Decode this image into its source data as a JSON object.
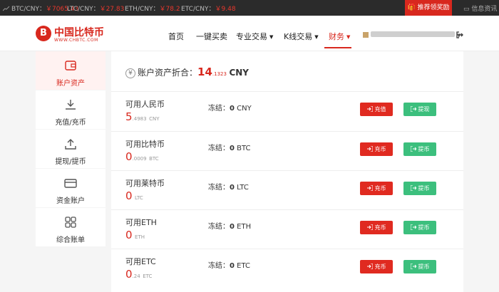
{
  "ticker": [
    {
      "pair": "BTC/CNY：",
      "price": "￥7065.43"
    },
    {
      "pair": "LTC/CNY：",
      "price": "￥27.83"
    },
    {
      "pair": "ETH/CNY：",
      "price": "￥78.2"
    },
    {
      "pair": "ETC/CNY：",
      "price": "￥9.48"
    }
  ],
  "promo_label": "推荐领奖励",
  "message_center": "信息资讯",
  "logo": {
    "name": "中国比特币",
    "url": "WWW.CHBTC.COM"
  },
  "nav": [
    "首页",
    "一键买卖",
    "专业交易",
    "K线交易",
    "财务"
  ],
  "sidebar": [
    "账户资产",
    "充值/充币",
    "提现/提币",
    "资金账户",
    "综合账单"
  ],
  "summary": {
    "label": "账户资产折合：",
    "int": "14",
    "frac": ".1323",
    "unit": "CNY"
  },
  "frozen_label": "冻结：",
  "rows": [
    {
      "name": "可用人民币",
      "int": "5",
      "frac": ".4983",
      "unit": "CNY",
      "frozen": "0",
      "deposit": "充值",
      "withdraw": "提现"
    },
    {
      "name": "可用比特币",
      "int": "0",
      "frac": ".0009",
      "unit": "BTC",
      "frozen": "0",
      "deposit": "充币",
      "withdraw": "提币"
    },
    {
      "name": "可用莱特币",
      "int": "0",
      "frac": "",
      "unit": "LTC",
      "frozen": "0",
      "deposit": "充币",
      "withdraw": "提币"
    },
    {
      "name": "可用ETH",
      "int": "0",
      "frac": "",
      "unit": "ETH",
      "frozen": "0",
      "deposit": "充币",
      "withdraw": "提币"
    },
    {
      "name": "可用ETC",
      "int": "0",
      "frac": ".24",
      "unit": "ETC",
      "frozen": "0",
      "deposit": "充币",
      "withdraw": "提币"
    }
  ],
  "colors": {
    "brand": "#d8281e",
    "withdraw": "#3cbf7d",
    "ticker_bg": "#2b2b2b"
  }
}
